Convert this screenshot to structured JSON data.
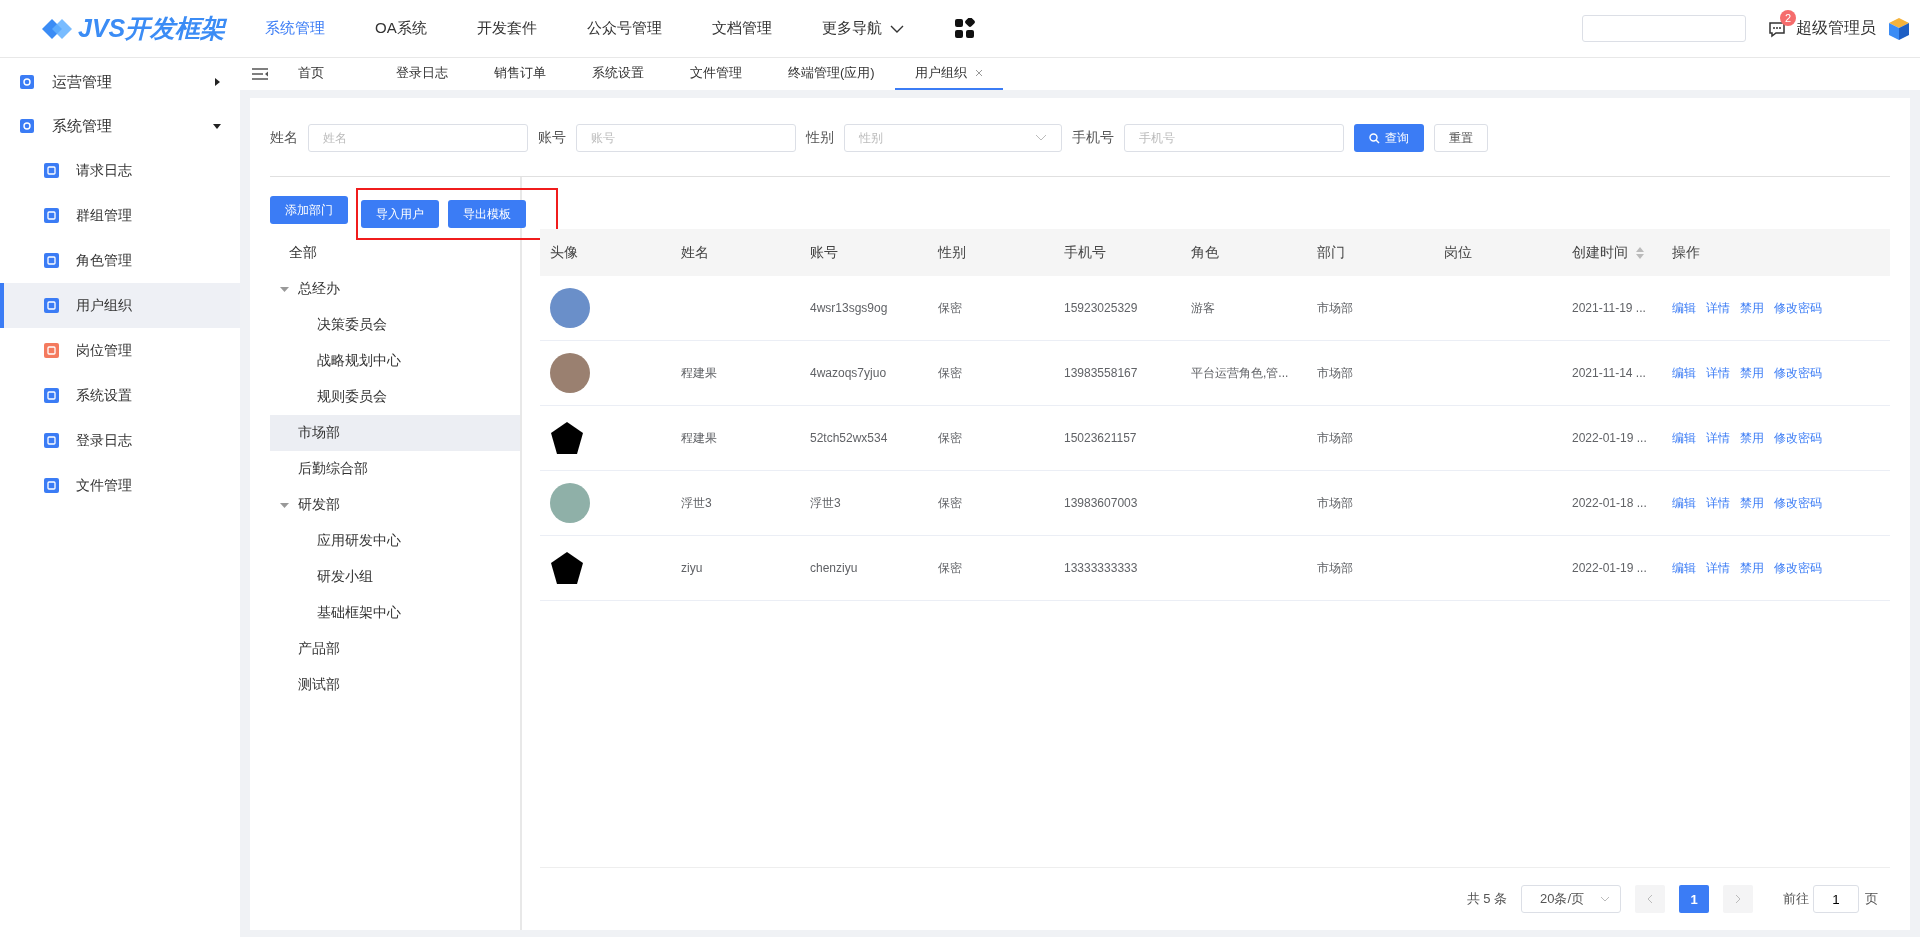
{
  "header": {
    "logo_text": "JVS开发框架",
    "nav": [
      {
        "label": "系统管理",
        "selected": true
      },
      {
        "label": "OA系统",
        "selected": false
      },
      {
        "label": "开发套件",
        "selected": false
      },
      {
        "label": "公众号管理",
        "selected": false
      },
      {
        "label": "文档管理",
        "selected": false
      },
      {
        "label": "更多导航",
        "selected": false
      }
    ],
    "notification_count": "2",
    "user_name": "超级管理员"
  },
  "sidebar": {
    "items": [
      {
        "label": "运营管理",
        "expanded": false
      },
      {
        "label": "系统管理",
        "expanded": true,
        "children": [
          {
            "label": "请求日志",
            "selected": false,
            "color": "#3b7cf5"
          },
          {
            "label": "群组管理",
            "selected": false,
            "color": "#3b7cf5"
          },
          {
            "label": "角色管理",
            "selected": false,
            "color": "#3b7cf5"
          },
          {
            "label": "用户组织",
            "selected": true,
            "color": "#3b7cf5"
          },
          {
            "label": "岗位管理",
            "selected": false,
            "color": "#f47a5e"
          },
          {
            "label": "系统设置",
            "selected": false,
            "color": "#3b7cf5"
          },
          {
            "label": "登录日志",
            "selected": false,
            "color": "#3b7cf5"
          },
          {
            "label": "文件管理",
            "selected": false,
            "color": "#3b7cf5"
          }
        ]
      }
    ]
  },
  "tabs": [
    {
      "label": "首页",
      "selected": false,
      "closable": false
    },
    {
      "label": "登录日志",
      "selected": false,
      "closable": false
    },
    {
      "label": "销售订单",
      "selected": false,
      "closable": false
    },
    {
      "label": "系统设置",
      "selected": false,
      "closable": false
    },
    {
      "label": "文件管理",
      "selected": false,
      "closable": false
    },
    {
      "label": "终端管理(应用)",
      "selected": false,
      "closable": false
    },
    {
      "label": "用户组织",
      "selected": true,
      "closable": true
    }
  ],
  "filters": [
    {
      "label": "姓名",
      "kind": "input",
      "placeholder": "姓名"
    },
    {
      "label": "账号",
      "kind": "input",
      "placeholder": "账号"
    },
    {
      "label": "性别",
      "kind": "select",
      "placeholder": "性别"
    },
    {
      "label": "手机号",
      "kind": "input",
      "placeholder": "手机号"
    }
  ],
  "search_button": "查询",
  "reset_button": "重置",
  "actions": [
    {
      "label": "添加部门",
      "highlighted": false
    },
    {
      "label": "导入用户",
      "highlighted": true
    },
    {
      "label": "导出模板",
      "highlighted": true
    }
  ],
  "tree": [
    {
      "label": "全部",
      "selected": false
    },
    {
      "label": "总经办",
      "selected": false,
      "expanded": true,
      "children": [
        {
          "label": "决策委员会",
          "selected": false
        },
        {
          "label": "战略规划中心",
          "selected": false
        },
        {
          "label": "规则委员会",
          "selected": false
        }
      ]
    },
    {
      "label": "市场部",
      "selected": true
    },
    {
      "label": "后勤综合部",
      "selected": false
    },
    {
      "label": "研发部",
      "selected": false,
      "expanded": true,
      "children": [
        {
          "label": "应用研发中心",
          "selected": false
        },
        {
          "label": "研发小组",
          "selected": false
        },
        {
          "label": "基础框架中心",
          "selected": false
        }
      ]
    },
    {
      "label": "产品部",
      "selected": false
    },
    {
      "label": "测试部",
      "selected": false
    }
  ],
  "table": {
    "columns": [
      "头像",
      "姓名",
      "账号",
      "性别",
      "手机号",
      "角色",
      "部门",
      "岗位",
      "创建时间",
      "操作"
    ],
    "rows": [
      {
        "kind": "photo",
        "account": "4wsr13sgs9og",
        "gender": "保密",
        "phone": "15923025329",
        "role": "游客",
        "department": "市场部",
        "created": "2021-11-19 ...",
        "operations": [
          "编辑",
          "详情",
          "禁用",
          "修改密码"
        ]
      },
      {
        "kind": "photo",
        "name": "程建果",
        "account": "4wazoqs7yjuo",
        "gender": "保密",
        "phone": "13983558167",
        "role": "平台运营角色,管...",
        "department": "市场部",
        "created": "2021-11-14 ...",
        "operations": [
          "编辑",
          "详情",
          "禁用",
          "修改密码"
        ]
      },
      {
        "kind": "logo",
        "name": "程建果",
        "account": "52tch52wx534",
        "gender": "保密",
        "phone": "15023621157",
        "department": "市场部",
        "created": "2022-01-19 ...",
        "operations": [
          "编辑",
          "详情",
          "禁用",
          "修改密码"
        ]
      },
      {
        "kind": "photo",
        "name": "浮世3",
        "account": "浮世3",
        "gender": "保密",
        "phone": "13983607003",
        "department": "市场部",
        "created": "2022-01-18 ...",
        "operations": [
          "编辑",
          "详情",
          "禁用",
          "修改密码"
        ]
      },
      {
        "kind": "logo",
        "name": "ziyu",
        "account": "chenziyu",
        "gender": "保密",
        "phone": "13333333333",
        "department": "市场部",
        "created": "2022-01-19 ...",
        "operations": [
          "编辑",
          "详情",
          "禁用",
          "修改密码"
        ]
      }
    ]
  },
  "pagination": {
    "total": "共 5 条",
    "page_size": "20条/页",
    "pages": [
      {
        "label": "1",
        "selected": true
      }
    ],
    "goto_label": "前往",
    "goto_value": "1",
    "page_suffix": "页"
  }
}
